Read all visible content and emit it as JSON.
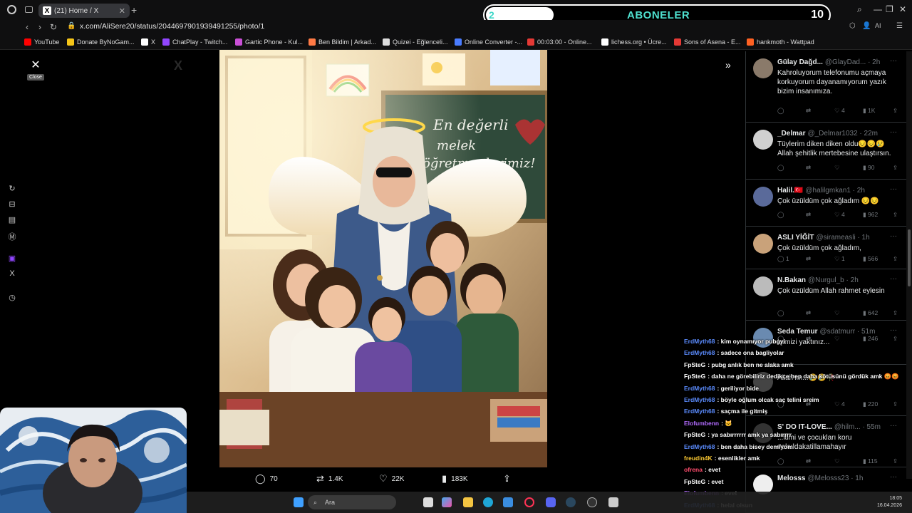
{
  "browser": {
    "tab_title": "(21) Home / X",
    "url": "x.com/AliSere20/status/2044697901939491255/photo/1"
  },
  "bookmarks": [
    {
      "label": "YouTube",
      "color": "#ff0000"
    },
    {
      "label": "Donate ByNoGam...",
      "color": "#f5c518"
    },
    {
      "label": "X",
      "color": "#ffffff"
    },
    {
      "label": "ChatPlay - Twitch...",
      "color": "#9146ff"
    },
    {
      "label": "Gartic Phone - Kul...",
      "color": "#c94fd6"
    },
    {
      "label": "Ben Bildim | Arkad...",
      "color": "#ff7a45"
    },
    {
      "label": "Quizei - Eğlenceli...",
      "color": "#dddddd"
    },
    {
      "label": "Online Converter -...",
      "color": "#4a7cff"
    },
    {
      "label": "00:03:00 - Online...",
      "color": "#e53935"
    },
    {
      "label": "lichess.org • Ücre...",
      "color": "#ffffff"
    },
    {
      "label": "Sons of Asena - E...",
      "color": "#e53935"
    },
    {
      "label": "hankmoth - Wattpad",
      "color": "#ff6122"
    }
  ],
  "subscriber_goal": {
    "current": "2",
    "label": "ABONELER",
    "goal": "10",
    "progress": 0.2
  },
  "viewer": {
    "close_tooltip": "Close",
    "actions": {
      "replies": "70",
      "reposts": "1.4K",
      "likes": "22K",
      "views": "183K"
    }
  },
  "photo": {
    "chalkboard_text": [
      "En değerli",
      "melek",
      "öğretmenlerimiz!"
    ]
  },
  "replies": [
    {
      "name": "Gülay Dağd...",
      "handle": "@GlayDad...",
      "time": "· 2h",
      "text": "Kahroluyorum telefonumu açmaya korkuyorum dayanamıyorum yazık bizim insanımıza.",
      "likes": "4",
      "views": "1K",
      "reposts": "",
      "comments": "",
      "avatar": "#8a7a6a"
    },
    {
      "name": "_Delmar",
      "handle": "@_Delmar1032",
      "time": "· 22m",
      "text": "Tüylerim diken diken oldu😔😔😢 Allah şehitlik mertebesine ulaştırsın.",
      "likes": "",
      "views": "90",
      "reposts": "",
      "comments": "",
      "avatar": "#d0d0d0"
    },
    {
      "name": "Halil.🇹🇷",
      "handle": "@halilgmkan1",
      "time": "· 2h",
      "text": "Çok üzüldüm çok ağladım 😔😔",
      "likes": "4",
      "views": "962",
      "reposts": "",
      "comments": "",
      "avatar": "#5a6a9a"
    },
    {
      "name": "ASLI YİĞİT",
      "handle": "@sirameasli",
      "time": "· 1h",
      "text": "Çok üzüldüm çok ağladım,",
      "likes": "1",
      "views": "566",
      "reposts": "",
      "comments": "1",
      "avatar": "#c9a27a"
    },
    {
      "name": "N.Bakan",
      "handle": "@Nurgul_b",
      "time": "· 2h",
      "text": "Çok üzüldüm Allah rahmet eylesin",
      "likes": "",
      "views": "642",
      "reposts": "",
      "comments": "",
      "avatar": "#bbbbbb"
    },
    {
      "name": "Seda Temur",
      "handle": "@sdatmurr",
      "time": "· 51m",
      "text": "İçimizi yaktınız...",
      "likes": "",
      "views": "246",
      "reposts": "",
      "comments": "",
      "avatar": "#6a8ab0"
    },
    {
      "name": "",
      "handle": "",
      "time": "",
      "text": "Allah'ım...😢😢🥀",
      "likes": "4",
      "views": "220",
      "reposts": "",
      "comments": "",
      "avatar": "#444"
    },
    {
      "name": "S' DO IT-LOVE...",
      "handle": "@hilm...",
      "time": "· 55m",
      "text": "...itimi ve çocukları koru #okuldakatillamahayır",
      "likes": "",
      "views": "115",
      "reposts": "",
      "comments": "",
      "avatar": "#333"
    },
    {
      "name": "Melosss",
      "handle": "@Melosss23",
      "time": "· 1h",
      "text": "",
      "likes": "",
      "views": "",
      "reposts": "",
      "comments": "",
      "avatar": "#eeeeee"
    }
  ],
  "chat": [
    {
      "user": "ErdMyth68",
      "color": "#5b8cff",
      "msg": ": kim oynamıyor pubgyi"
    },
    {
      "user": "ErdMyth68",
      "color": "#5b8cff",
      "msg": ": sadece ona bagliyolar"
    },
    {
      "user": "FpSteG",
      "color": "#ffffff",
      "msg": ": pubg anlık ben ne alaka amk"
    },
    {
      "user": "FpSteG",
      "color": "#ffffff",
      "msg": ": daha ne görebiliriz dedikçe hep daha kötüsünü gördük amk 😡😡"
    },
    {
      "user": "ErdMyth68",
      "color": "#5b8cff",
      "msg": ": geriliyor bide"
    },
    {
      "user": "ErdMyth68",
      "color": "#5b8cff",
      "msg": ": böyle oğlum olcak saç telini sreim"
    },
    {
      "user": "ErdMyth68",
      "color": "#5b8cff",
      "msg": ": saçma ile gitmiş"
    },
    {
      "user": "Elofumbenn",
      "color": "#b26bff",
      "msg": ": 🐱"
    },
    {
      "user": "FpSteG",
      "color": "#ffffff",
      "msg": ": ya sabırrrrrr amk ya sabırrrr"
    },
    {
      "user": "ErdMyth68",
      "color": "#5b8cff",
      "msg": ": ben daha bisey demiyom"
    },
    {
      "user": "freudin4K",
      "color": "#ffcc33",
      "msg": ": esenlikler amk"
    },
    {
      "user": "ofrena",
      "color": "#ff4d6d",
      "msg": ": evet"
    },
    {
      "user": "FpSteG",
      "color": "#ffffff",
      "msg": ": evet"
    },
    {
      "user": "Elofumbenn",
      "color": "#b26bff",
      "msg": ": evet"
    },
    {
      "user": "ErdMyth68",
      "color": "#5b8cff",
      "msg": ": helal olsun"
    }
  ],
  "taskbar": {
    "search_placeholder": "Ara",
    "time": "18:05",
    "date": "16.04.2026"
  }
}
